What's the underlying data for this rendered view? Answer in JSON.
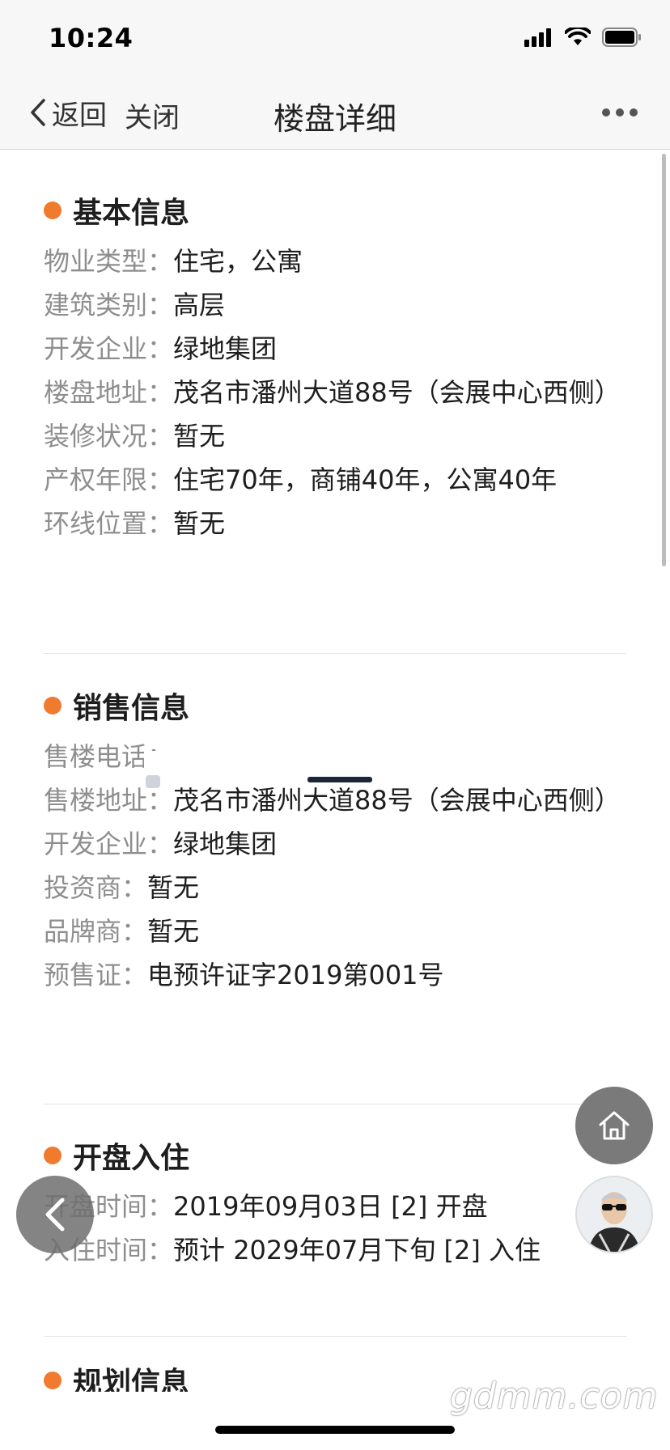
{
  "status": {
    "time": "10:24"
  },
  "nav": {
    "back_label": "返回",
    "close_label": "关闭",
    "title": "楼盘详细"
  },
  "basic": {
    "title": "基本信息",
    "rows": [
      {
        "label": "物业类型：",
        "value": "住宅，公寓"
      },
      {
        "label": "建筑类别：",
        "value": "高层"
      },
      {
        "label": "开发企业：",
        "value": "绿地集团"
      },
      {
        "label": "楼盘地址：",
        "value": "茂名市潘州大道88号（会展中心西侧）"
      },
      {
        "label": "装修状况：",
        "value": "暂无"
      },
      {
        "label": "产权年限：",
        "value": "住宅70年，商铺40年，公寓40年"
      },
      {
        "label": "环线位置：",
        "value": "暂无"
      }
    ]
  },
  "sales": {
    "title": "销售信息",
    "rows": [
      {
        "label": "售楼电话：",
        "value": ""
      },
      {
        "label": "售楼地址：",
        "value": "茂名市潘州大道88号（会展中心西侧）"
      },
      {
        "label": "开发企业：",
        "value": "绿地集团"
      },
      {
        "label": "投资商：",
        "value": "暂无"
      },
      {
        "label": "品牌商：",
        "value": "暂无"
      },
      {
        "label": "预售证：",
        "value": "电预许证字2019第001号"
      }
    ]
  },
  "opening": {
    "title": "开盘入住",
    "rows": [
      {
        "label": "开盘时间：",
        "value": "2019年09月03日 [2] 开盘"
      },
      {
        "label": "入住时间：",
        "value": "预计 2029年07月下旬 [2] 入住"
      }
    ]
  },
  "planning": {
    "title": "规划信息"
  },
  "watermark": "gdmm.com"
}
